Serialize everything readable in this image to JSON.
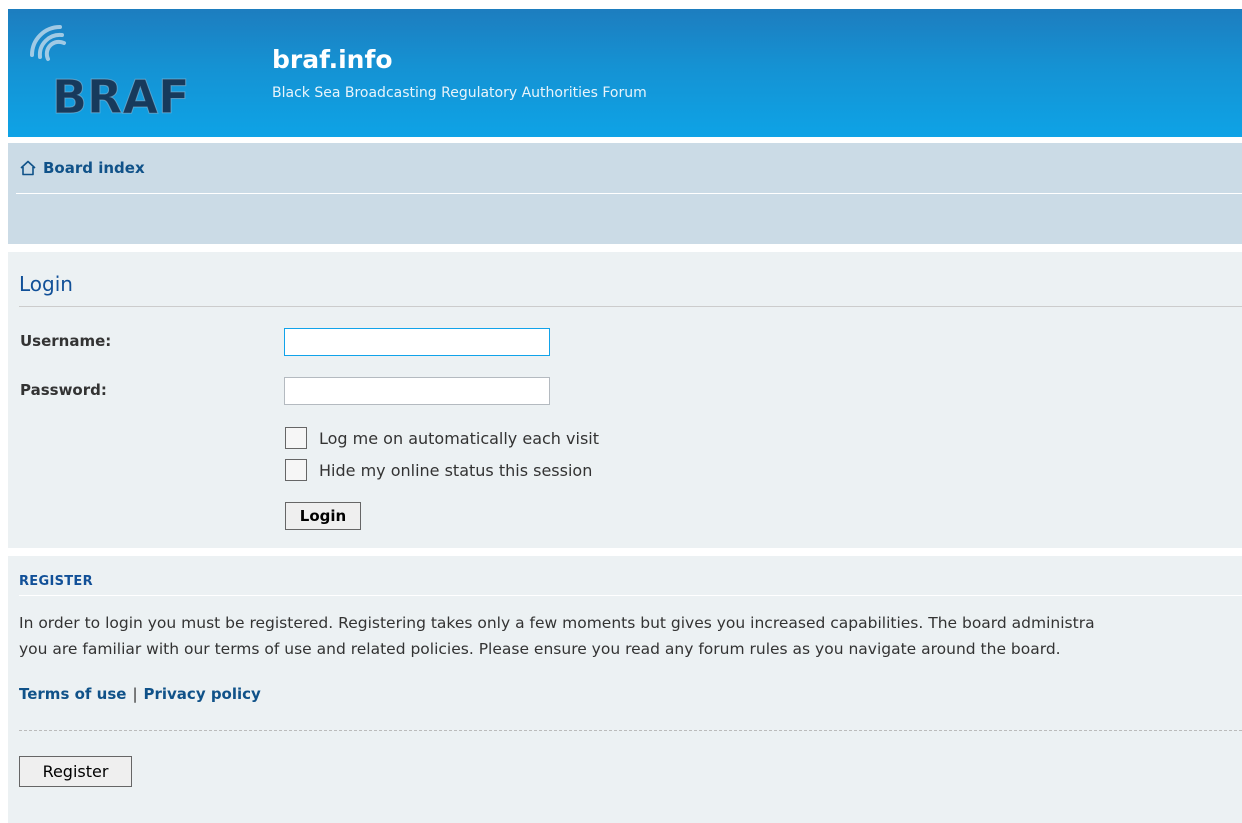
{
  "header": {
    "logo_text": "BRAF",
    "site_title": "braf.info",
    "site_description": "Black Sea Broadcasting Regulatory Authorities Forum"
  },
  "nav": {
    "board_index_label": "Board index",
    "home_icon": "home-icon"
  },
  "login": {
    "heading": "Login",
    "username_label": "Username:",
    "username_value": "",
    "password_label": "Password:",
    "password_value": "",
    "autologin_label": "Log me on automatically each visit",
    "autologin_checked": false,
    "hide_status_label": "Hide my online status this session",
    "hide_status_checked": false,
    "submit_label": "Login"
  },
  "register": {
    "heading": "REGISTER",
    "text_line1": "In order to login you must be registered. Registering takes only a few moments but gives you increased capabilities. The board administra",
    "text_line2": "you are familiar with our terms of use and related policies. Please ensure you read any forum rules as you navigate around the board.",
    "terms_label": "Terms of use",
    "separator": "|",
    "privacy_label": "Privacy policy",
    "button_label": "Register"
  },
  "colors": {
    "header_top": "#1d7dbf",
    "header_bottom": "#0ea3e6",
    "navbar_bg": "#cbdbe6",
    "panel_bg": "#ecf1f3",
    "link": "#105289",
    "heading": "#115098"
  }
}
